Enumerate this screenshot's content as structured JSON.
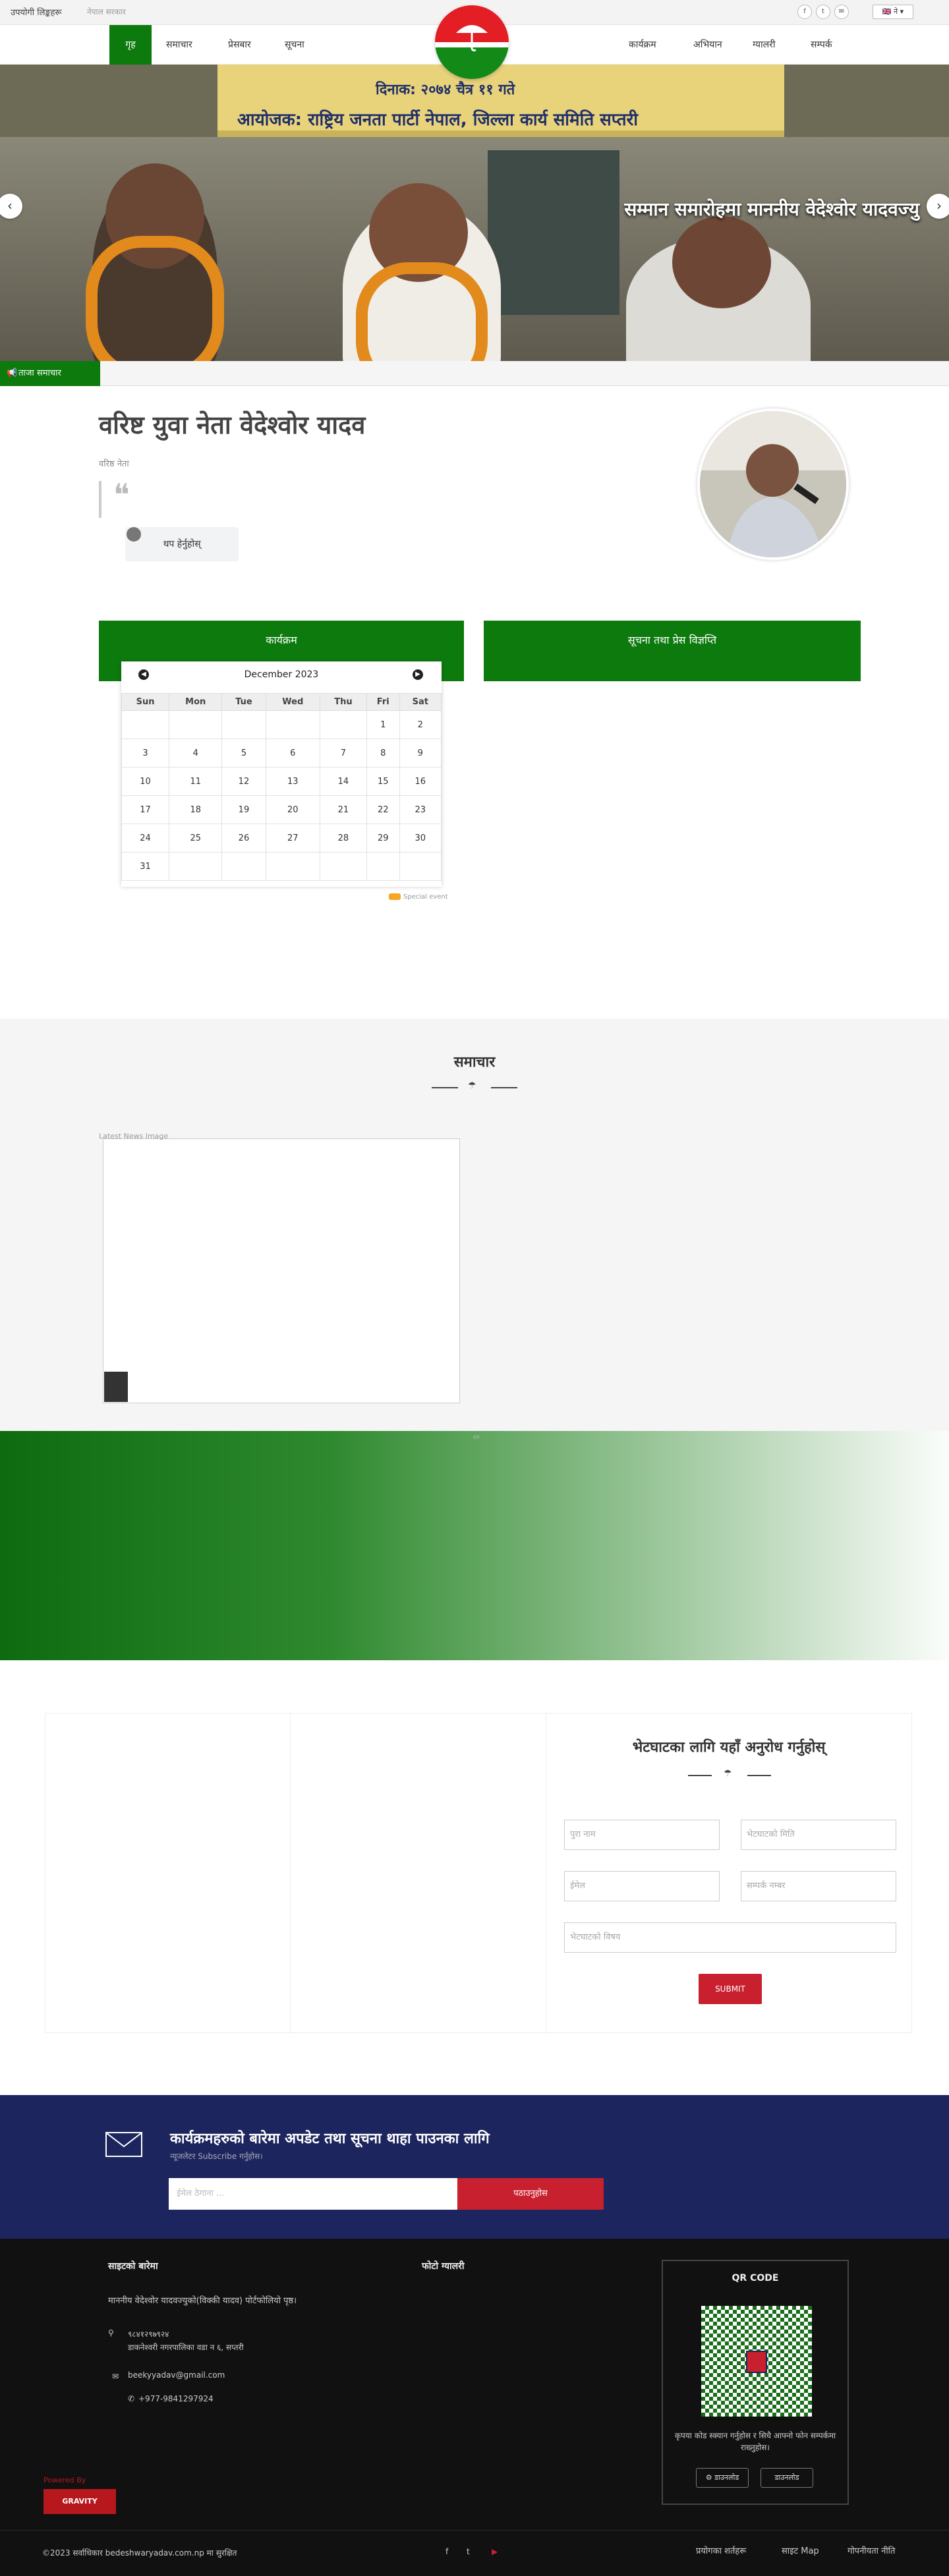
{
  "topbar": {
    "link1": "उपयोगी लिङ्कहरू",
    "link2": "नेपाल सरकार",
    "lang": "🇬🇧 ने ▾"
  },
  "nav": {
    "left": [
      "गृह",
      "समाचार",
      "प्रेसबार",
      "सूचना"
    ],
    "right": [
      "कार्यक्रम",
      "अभियान",
      "ग्यालरी",
      "सम्पर्क"
    ]
  },
  "slider": {
    "banner_line1": "दिनाक: २०७४ चैत्र ११ गते",
    "banner_line2": "आयोजक: राष्ट्रिय जनता पार्टी नेपाल, जिल्ला कार्य समिति सप्तरी",
    "caption": "सम्मान समारोहमा माननीय वेदेश्वोर यादवज्यु"
  },
  "ticker": {
    "label": "ताजा समाचार"
  },
  "profile": {
    "title": "वरिष्ट युवा नेता वेदेश्वोर यादव",
    "subtitle": "वरिष्ठ नेता",
    "more_button": "थप हेर्नुहोस्"
  },
  "sections": {
    "events": "कार्यक्रम",
    "notices": "सूचना तथा प्रेस विज्ञप्ति"
  },
  "calendar": {
    "month": "December 2023",
    "days": [
      "Sun",
      "Mon",
      "Tue",
      "Wed",
      "Thu",
      "Fri",
      "Sat"
    ],
    "weeks": [
      [
        "",
        "",
        "",
        "",
        "",
        "1",
        "2"
      ],
      [
        "3",
        "4",
        "5",
        "6",
        "7",
        "8",
        "9"
      ],
      [
        "10",
        "11",
        "12",
        "13",
        "14",
        "15",
        "16"
      ],
      [
        "17",
        "18",
        "19",
        "20",
        "21",
        "22",
        "23"
      ],
      [
        "24",
        "25",
        "26",
        "27",
        "28",
        "29",
        "30"
      ],
      [
        "31",
        "",
        "",
        "",
        "",
        "",
        ""
      ]
    ],
    "legend": "Special event"
  },
  "news": {
    "title": "समाचार",
    "image_alt": "Latest News Image"
  },
  "contact": {
    "title": "भेटघाटका लागि यहाँ अनुरोध गर्नुहोस्",
    "name": "पुरा नाम",
    "date": "भेटघाटको मिति",
    "email": "ईमेल",
    "phone": "सम्पर्क नम्बर",
    "subject": "भेटघाटको विषय",
    "submit": "SUBMIT"
  },
  "subscribe": {
    "title": "कार्यक्रमहरुको बारेमा अपडेट तथा सूचना थाहा पाउनका लागि",
    "subtitle": "न्यूजलेटर Subscribe गर्नुहोस।",
    "placeholder": "ईमेल ठेगाना ...",
    "button": "पठाउनुहोस"
  },
  "footer": {
    "about_title": "साइटको बारेमा",
    "about_text": "माननीय वेदेश्वोर यादवज्युको(विक्की यादव) पोर्टफोलियो पृष्ठ।",
    "address1": "९८४१२९७९२४",
    "address2": "डाकनेश्वरी नगरपालिका वडा न ६, सप्तरी",
    "email": "beekyyadav@gmail.com",
    "phone": "+977-9841297924",
    "photo_title": "फोटो ग्यालरी",
    "qr_title": "QR CODE",
    "qr_text": "कृपया कोड स्क्यान गर्नुहोस र सिधै आफ्नो फोन सम्पर्कमा राख्नुहोस।",
    "android": "डाउनलोड",
    "ios": "डाउनलोड",
    "powered": "Powered By",
    "gravity": "GRAVITY",
    "copyright": "©2023 सर्वाधिकार bedeshwaryadav.com.np मा सुरक्षित",
    "links": [
      "प्रयोगका शर्तहरू",
      "साइट Map",
      "गोपनीयता नीति"
    ]
  },
  "colors": {
    "primary_green": "#0d7a0e",
    "accent_red": "#c8202e",
    "navy": "#1d255e"
  }
}
